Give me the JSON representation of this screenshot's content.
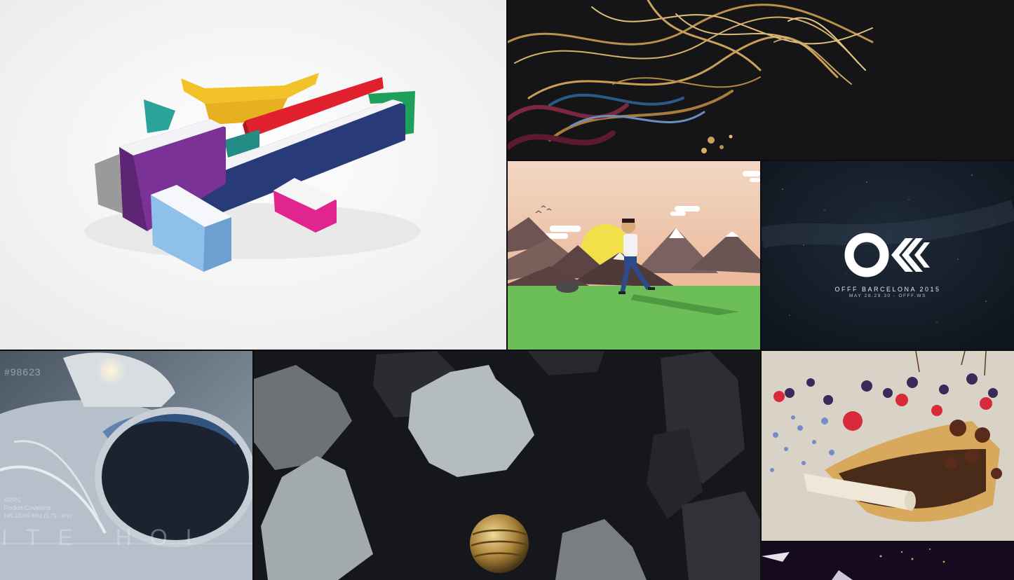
{
  "gallery": {
    "tiles": [
      {
        "id": "channel4-ident"
      },
      {
        "id": "golden-fibers"
      },
      {
        "id": "mountain-walker"
      },
      {
        "id": "offf-barcelona"
      },
      {
        "id": "astronaut"
      },
      {
        "id": "floating-rocks"
      },
      {
        "id": "dessert-berries"
      },
      {
        "id": "dark-particles"
      }
    ]
  },
  "offf": {
    "logo_text": "OFF",
    "line1": "OFFF BARCELONA 2015",
    "line2": "MAY 28.29.30 - OFFF.WS"
  },
  "astronaut": {
    "hud_number": "#98623",
    "hud_line1": "ARRS",
    "hud_line2": "Pocket Coverline",
    "hud_line3": "145.18200 Mhz (1.75 - Kru)",
    "hud_big": "ITE HOI"
  },
  "colors": {
    "c4_yellow": "#f2c228",
    "c4_red": "#e0202c",
    "c4_green": "#1fa05a",
    "c4_teal": "#2aa39a",
    "c4_purple": "#7a3296",
    "c4_navy": "#283a78",
    "c4_lightblue": "#8fc0ea",
    "c4_magenta": "#e0268e",
    "c4_grey": "#9a9a9a"
  }
}
